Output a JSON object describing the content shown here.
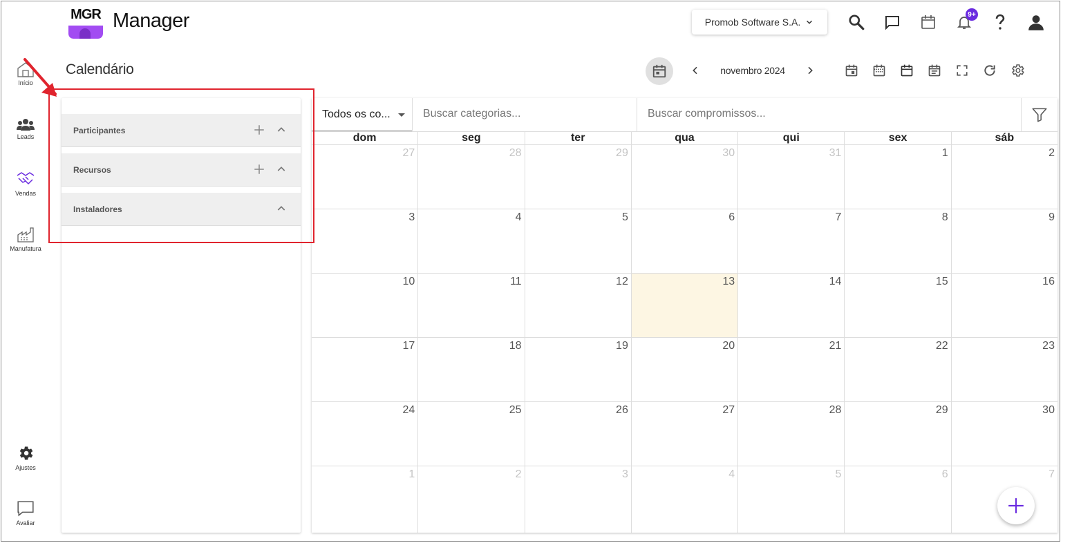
{
  "header": {
    "logo_text": "MGR",
    "app_title": "Manager",
    "company": "Promob Software S.A.",
    "notification_badge": "9+"
  },
  "rail": {
    "items": [
      {
        "label": "Início",
        "icon": "home-icon"
      },
      {
        "label": "Leads",
        "icon": "people-icon"
      },
      {
        "label": "Vendas",
        "icon": "handshake-icon"
      },
      {
        "label": "Manufatura",
        "icon": "factory-icon"
      },
      {
        "label": "Ajustes",
        "icon": "gear-icon"
      },
      {
        "label": "Avaliar",
        "icon": "feedback-icon"
      }
    ]
  },
  "page": {
    "title": "Calendário"
  },
  "toolbar": {
    "month": "novembro 2024"
  },
  "side_panel": {
    "sections": [
      {
        "label": "Participantes",
        "addable": true
      },
      {
        "label": "Recursos",
        "addable": true
      },
      {
        "label": "Instaladores",
        "addable": false
      }
    ]
  },
  "filters": {
    "category_select": "Todos os co...",
    "category_search_placeholder": "Buscar categorias...",
    "appointment_search_placeholder": "Buscar compromissos..."
  },
  "calendar": {
    "weekdays": [
      "dom",
      "seg",
      "ter",
      "qua",
      "qui",
      "sex",
      "sáb"
    ],
    "today": 13,
    "weeks": [
      [
        {
          "d": "27",
          "o": true
        },
        {
          "d": "28",
          "o": true
        },
        {
          "d": "29",
          "o": true
        },
        {
          "d": "30",
          "o": true
        },
        {
          "d": "31",
          "o": true
        },
        {
          "d": "1"
        },
        {
          "d": "2"
        }
      ],
      [
        {
          "d": "3"
        },
        {
          "d": "4"
        },
        {
          "d": "5"
        },
        {
          "d": "6"
        },
        {
          "d": "7"
        },
        {
          "d": "8"
        },
        {
          "d": "9"
        }
      ],
      [
        {
          "d": "10"
        },
        {
          "d": "11"
        },
        {
          "d": "12"
        },
        {
          "d": "13"
        },
        {
          "d": "14"
        },
        {
          "d": "15"
        },
        {
          "d": "16"
        }
      ],
      [
        {
          "d": "17"
        },
        {
          "d": "18"
        },
        {
          "d": "19"
        },
        {
          "d": "20"
        },
        {
          "d": "21"
        },
        {
          "d": "22"
        },
        {
          "d": "23"
        }
      ],
      [
        {
          "d": "24"
        },
        {
          "d": "25"
        },
        {
          "d": "26"
        },
        {
          "d": "27"
        },
        {
          "d": "28"
        },
        {
          "d": "29"
        },
        {
          "d": "30"
        }
      ],
      [
        {
          "d": "1",
          "o": true
        },
        {
          "d": "2",
          "o": true
        },
        {
          "d": "3",
          "o": true
        },
        {
          "d": "4",
          "o": true
        },
        {
          "d": "5",
          "o": true
        },
        {
          "d": "6",
          "o": true
        },
        {
          "d": "7",
          "o": true
        }
      ]
    ]
  },
  "colors": {
    "accent": "#6a2be0",
    "logo_purple": "#a24cf2",
    "today_bg": "#fdf6e3",
    "annotation_red": "#e0242e"
  }
}
